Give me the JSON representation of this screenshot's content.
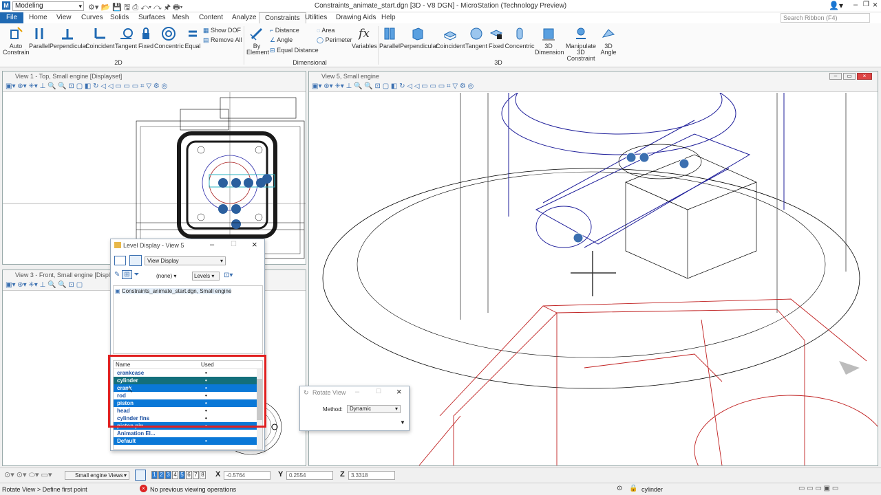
{
  "titlebar": {
    "workflow": "Modeling",
    "title": "Constraints_animate_start.dgn [3D - V8 DGN] - MicroStation (Technology Preview)"
  },
  "menu": [
    "File",
    "Home",
    "View",
    "Curves",
    "Solids",
    "Surfaces",
    "Mesh",
    "Content",
    "Analyze",
    "Constraints",
    "Utilities",
    "Drawing Aids",
    "Help"
  ],
  "ribbon_search": "Search Ribbon (F4)",
  "ribbon": {
    "auto_constrain": "Auto Constrain",
    "g2d": [
      "Parallel",
      "Perpendicular",
      "Coincident",
      "Tangent",
      "Fixed",
      "Concentric",
      "Equal"
    ],
    "show_dof": "Show DOF",
    "remove_all": "Remove All",
    "group_2d": "2D",
    "by_element": "By Element",
    "distance": "Distance",
    "angle": "Angle",
    "equal_distance": "Equal Distance",
    "area": "Area",
    "perimeter": "Perimeter",
    "variables": "Variables",
    "group_dim": "Dimensional",
    "g3d": [
      "Parallel",
      "Perpendicular",
      "Coincident",
      "Tangent",
      "Fixed",
      "Concentric"
    ],
    "dimension_3d": "3D Dimension",
    "manipulate": "Manipulate 3D Constraint",
    "angle_3d": "3D Angle",
    "group_3d": "3D"
  },
  "views": {
    "v1": "View 1 - Top, Small engine [Displayset]",
    "v3": "View 3 - Front, Small engine [Displayset]",
    "v5": "View 5, Small engine"
  },
  "level_dialog": {
    "title": "Level Display - View 5",
    "mode": "View Display",
    "filter": "(none)",
    "levels": "Levels",
    "tree_item": "Constraints_animate_start.dgn, Small engine",
    "col_name": "Name",
    "col_used": "Used",
    "rows": [
      {
        "name": "crankcase",
        "used": "•",
        "state": ""
      },
      {
        "name": "cylinder",
        "used": "•",
        "state": "sel2"
      },
      {
        "name": "crank",
        "used": "•",
        "state": "sel"
      },
      {
        "name": "rod",
        "used": "•",
        "state": ""
      },
      {
        "name": "piston",
        "used": "•",
        "state": "sel"
      },
      {
        "name": "head",
        "used": "•",
        "state": ""
      },
      {
        "name": "cylinder fins",
        "used": "•",
        "state": ""
      },
      {
        "name": "piston pin",
        "used": "•",
        "state": "sel"
      },
      {
        "name": "Animation El...",
        "used": "",
        "state": ""
      },
      {
        "name": "Default",
        "used": "•",
        "state": "sel"
      }
    ]
  },
  "rotate_dialog": {
    "title": "Rotate View",
    "method_label": "Method:",
    "method": "Dynamic"
  },
  "bottom": {
    "view_groups": "Small engine Views",
    "view_nums": [
      "1",
      "2",
      "3",
      "4",
      "5",
      "6",
      "7",
      "8"
    ],
    "x_label": "X",
    "x": "-0.5764",
    "y_label": "Y",
    "y": "0.2554",
    "z_label": "Z",
    "z": "3.3318"
  },
  "status": {
    "prompt": "Rotate View > Define first point",
    "message": "No previous viewing operations",
    "active_level": "cylinder"
  },
  "colors": {
    "accent": "#1f69b3",
    "selection": "#0a78d7",
    "highlight": "#e02020"
  }
}
